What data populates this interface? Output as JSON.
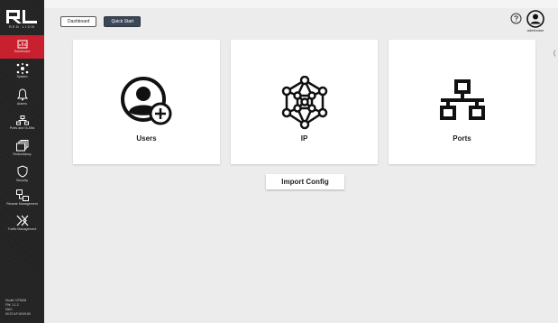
{
  "brand": {
    "logo_text": "RED LION",
    "accent": "#c8202e"
  },
  "sidebar": {
    "items": [
      {
        "label": "Dashboard",
        "icon": "dashboard-icon",
        "active": true
      },
      {
        "label": "System",
        "icon": "system-icon"
      },
      {
        "label": "Alarms",
        "icon": "bell-icon"
      },
      {
        "label": "Ports and VLANs",
        "icon": "ports-vlans-icon"
      },
      {
        "label": "Redundancy",
        "icon": "redundancy-icon"
      },
      {
        "label": "Security",
        "icon": "shield-icon"
      },
      {
        "label": "Remote Management",
        "icon": "remote-management-icon"
      },
      {
        "label": "Traffic Management",
        "icon": "traffic-management-icon"
      }
    ],
    "device_info": {
      "model": "Model: NT5008",
      "fw": "FW: 1.1.2",
      "mac_label": "MAC:",
      "mac": "00:07:AF:00:00:60"
    }
  },
  "header": {
    "tabs": [
      {
        "label": "Dashboard",
        "active": false
      },
      {
        "label": "Quick Start",
        "active": true
      }
    ],
    "help_icon": "help-icon",
    "user_icon": "user-icon",
    "username": "adminuser"
  },
  "cards": [
    {
      "label": "Users",
      "icon": "user-add-icon"
    },
    {
      "label": "IP",
      "icon": "network-nodes-icon"
    },
    {
      "label": "Ports",
      "icon": "ports-icon"
    }
  ],
  "actions": {
    "import_label": "Import Config"
  }
}
